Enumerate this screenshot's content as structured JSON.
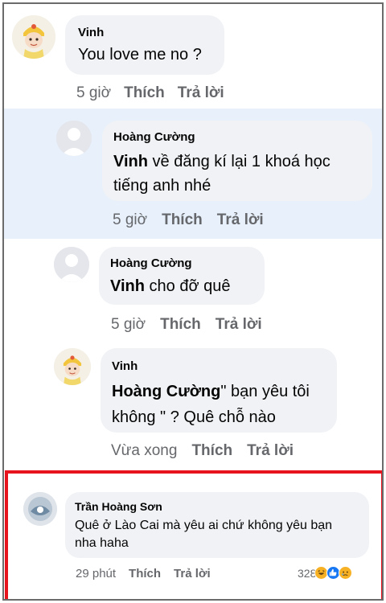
{
  "comments": [
    {
      "id": "c1",
      "author": "Vinh",
      "text": "You love me no ?",
      "time": "5 giờ",
      "like_label": "Thích",
      "reply_label": "Trả lời"
    }
  ],
  "replies": [
    {
      "id": "r1",
      "author": "Hoàng Cường",
      "mention": "Vinh",
      "text": " về đăng kí lại 1 khoá học tiếng anh nhé",
      "time": "5 giờ",
      "like_label": "Thích",
      "reply_label": "Trả lời"
    },
    {
      "id": "r2",
      "author": "Hoàng Cường",
      "mention": "Vinh",
      "text": " cho đỡ quê",
      "time": "5 giờ",
      "like_label": "Thích",
      "reply_label": "Trả lời"
    },
    {
      "id": "r3",
      "author": "Vinh",
      "mention": "Hoàng Cường",
      "text": "\" bạn yêu tôi không \" ? Quê chỗ nào",
      "time": "Vừa xong",
      "like_label": "Thích",
      "reply_label": "Trả lời"
    }
  ],
  "highlighted_comment": {
    "author": "Trần Hoàng Sơn",
    "text": "Quê ở Lào Cai mà yêu ai chứ không yêu bạn nha haha",
    "time": "29 phút",
    "like_label": "Thích",
    "reply_label": "Trả lời",
    "reaction_count": "328",
    "reactions": [
      "haha-icon",
      "like-icon",
      "sad-icon"
    ]
  },
  "colors": {
    "bubble": "#f0f2f5",
    "highlight_band": "#e7f0fb",
    "meta_text": "#65676b",
    "red_frame": "#e8141d",
    "like_blue": "#1877f2"
  }
}
